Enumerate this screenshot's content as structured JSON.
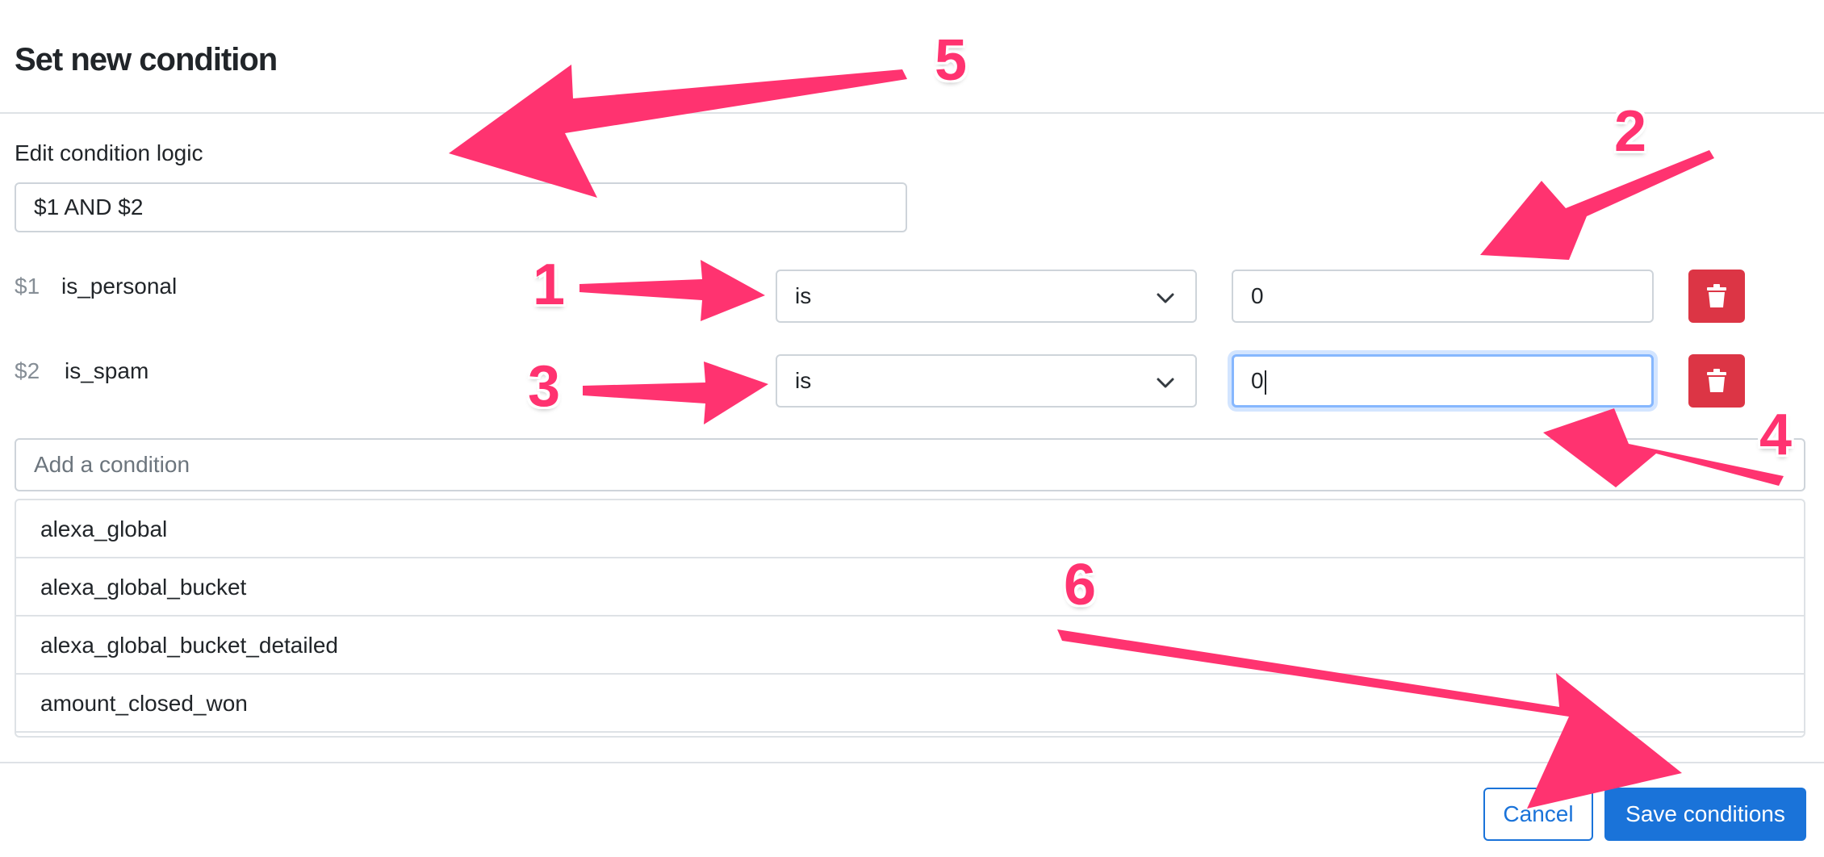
{
  "dialog": {
    "title": "Set new condition",
    "logic_label": "Edit condition logic",
    "logic_value": "$1 AND $2"
  },
  "conditions": [
    {
      "num": "$1",
      "name": "is_personal",
      "operator": "is",
      "value": "0"
    },
    {
      "num": "$2",
      "name": "is_spam",
      "operator": "is",
      "value": "0"
    }
  ],
  "add_condition": {
    "placeholder": "Add a condition"
  },
  "dropdown_options": [
    "alexa_global",
    "alexa_global_bucket",
    "alexa_global_bucket_detailed",
    "amount_closed_won"
  ],
  "footer": {
    "cancel_label": "Cancel",
    "save_label": "Save conditions"
  },
  "annotations": [
    "1",
    "2",
    "3",
    "4",
    "5",
    "6"
  ],
  "colors": {
    "annotation": "#ff3370",
    "primary": "#1a73d9",
    "danger": "#dc3545",
    "focus": "#86b7fe"
  },
  "icons": {
    "operator_select": "chevron-down-icon",
    "delete": "trash-icon"
  }
}
